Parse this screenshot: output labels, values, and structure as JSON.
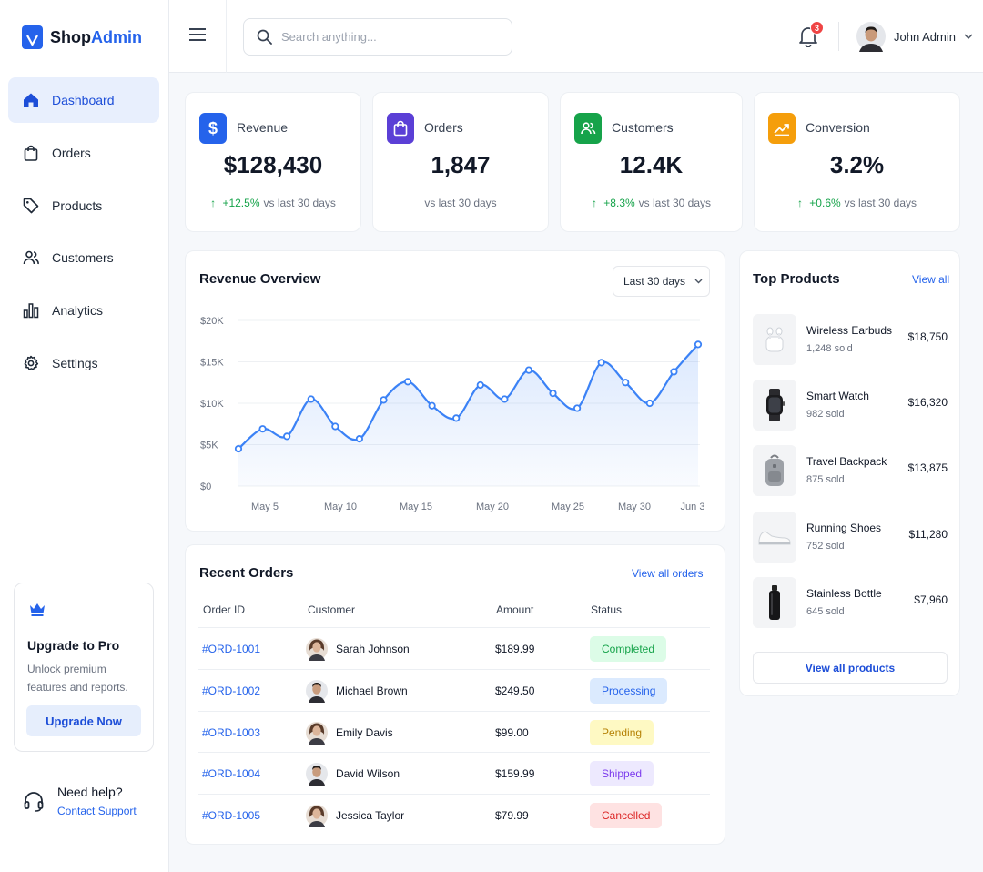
{
  "brand": {
    "name_prefix": "Shop",
    "name_accent": "Admin"
  },
  "sidebar": {
    "items": [
      {
        "label": "Dashboard",
        "icon": "home-icon"
      },
      {
        "label": "Orders",
        "icon": "shopping-bag-icon"
      },
      {
        "label": "Products",
        "icon": "tag-icon"
      },
      {
        "label": "Customers",
        "icon": "users-icon"
      },
      {
        "label": "Analytics",
        "icon": "bar-chart-icon"
      },
      {
        "label": "Settings",
        "icon": "gear-icon"
      }
    ],
    "upgrade": {
      "title": "Upgrade to Pro",
      "text": "Unlock premium features and reports.",
      "button": "Upgrade Now"
    },
    "help": {
      "title": "Need help?",
      "link": "Contact Support"
    }
  },
  "topbar": {
    "search_placeholder": "Search anything...",
    "notification_count": "3",
    "user_name": "John Admin"
  },
  "stats": [
    {
      "label": "Revenue",
      "value": "$128,430",
      "delta": "+12.5%",
      "sub": "vs last 30 days",
      "color": "#2563eb",
      "icon": "dollar-icon"
    },
    {
      "label": "Orders",
      "value": "1,847",
      "delta": "",
      "sub": "vs last 30 days",
      "color": "#5b3fd6",
      "icon": "shopping-bag-icon"
    },
    {
      "label": "Customers",
      "value": "12.4K",
      "delta": "+8.3%",
      "sub": "vs last 30 days",
      "color": "#16a34a",
      "icon": "users-icon"
    },
    {
      "label": "Conversion",
      "value": "3.2%",
      "delta": "+0.6%",
      "sub": "vs last 30 days",
      "color": "#f59e0b",
      "icon": "trend-up-icon"
    }
  ],
  "revenue": {
    "title": "Revenue Overview",
    "range": "Last 30 days"
  },
  "chart_data": {
    "type": "area",
    "title": "Revenue Overview",
    "x_ticks": [
      "May 5",
      "May 10",
      "May 15",
      "May 20",
      "May 25",
      "May 30",
      "Jun 3"
    ],
    "y_ticks": [
      "$0",
      "$5K",
      "$10K",
      "$15K",
      "$20K"
    ],
    "ylim": [
      0,
      20000
    ],
    "grid": true,
    "color": "#3b82f6",
    "series": [
      {
        "values": [
          4500,
          6900,
          6000,
          10500,
          7200,
          5700,
          10400,
          12600,
          9700,
          8200,
          12200,
          10500,
          14000,
          11200,
          9400,
          14900,
          12500,
          10000,
          13800,
          17100
        ]
      }
    ]
  },
  "orders": {
    "title": "Recent Orders",
    "view_all": "View all orders",
    "columns": [
      "Order ID",
      "Customer",
      "Amount",
      "Status"
    ],
    "rows": [
      {
        "id": "#ORD-1001",
        "customer": "Sarah Johnson",
        "amount": "$189.99",
        "status": "Completed",
        "bg": "#dcfce7",
        "fg": "#16a34a",
        "avatar": "female"
      },
      {
        "id": "#ORD-1002",
        "customer": "Michael Brown",
        "amount": "$249.50",
        "status": "Processing",
        "bg": "#dbeafe",
        "fg": "#2563eb",
        "avatar": "male"
      },
      {
        "id": "#ORD-1003",
        "customer": "Emily Davis",
        "amount": "$99.00",
        "status": "Pending",
        "bg": "#fef9c3",
        "fg": "#b58105",
        "avatar": "female"
      },
      {
        "id": "#ORD-1004",
        "customer": "David Wilson",
        "amount": "$159.99",
        "status": "Shipped",
        "bg": "#ede9fe",
        "fg": "#7c3aed",
        "avatar": "male"
      },
      {
        "id": "#ORD-1005",
        "customer": "Jessica Taylor",
        "amount": "$79.99",
        "status": "Cancelled",
        "bg": "#fee2e2",
        "fg": "#dc2626",
        "avatar": "female"
      }
    ]
  },
  "top_products": {
    "title": "Top Products",
    "view_all": "View all",
    "button": "View all products",
    "items": [
      {
        "name": "Wireless Earbuds",
        "sold": "1,248 sold",
        "price": "$18,750",
        "icon": "earbuds-icon"
      },
      {
        "name": "Smart Watch",
        "sold": "982 sold",
        "price": "$16,320",
        "icon": "watch-icon"
      },
      {
        "name": "Travel Backpack",
        "sold": "875 sold",
        "price": "$13,875",
        "icon": "backpack-icon"
      },
      {
        "name": "Running Shoes",
        "sold": "752 sold",
        "price": "$11,280",
        "icon": "shoe-icon"
      },
      {
        "name": "Stainless Bottle",
        "sold": "645 sold",
        "price": "$7,960",
        "icon": "bottle-icon"
      }
    ]
  }
}
